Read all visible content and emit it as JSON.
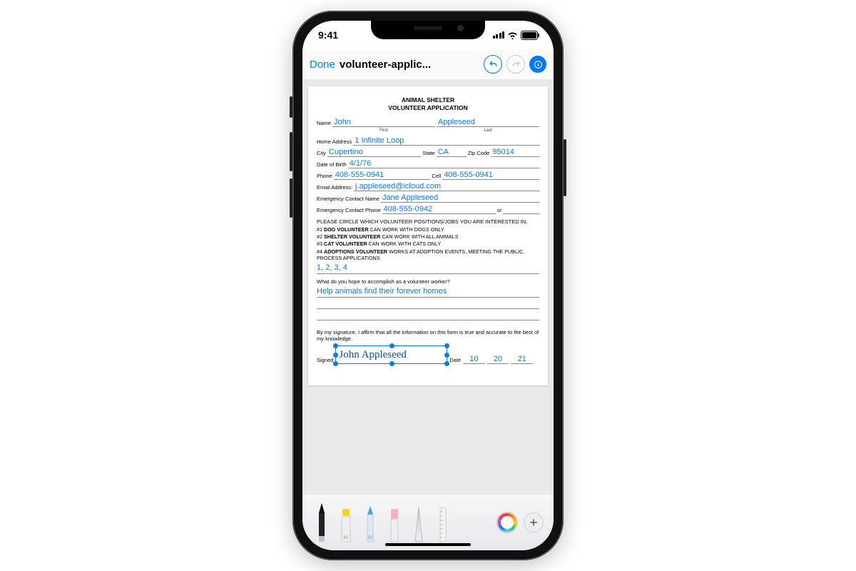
{
  "status": {
    "time": "9:41"
  },
  "nav": {
    "done": "Done",
    "title": "volunteer-applic..."
  },
  "form": {
    "header1": "ANIMAL SHELTER",
    "header2": "VOLUNTEER APPLICATION",
    "labels": {
      "name": "Name",
      "first": "First",
      "last": "Last",
      "addr": "Home Address",
      "city": "City",
      "state": "State",
      "zip": "Zip Code",
      "dob": "Date of Birth",
      "phone": "Phone",
      "cell": "Cell",
      "email": "Email Address:",
      "ec_name": "Emergency Contact Name",
      "ec_phone": "Emergency Contact Phone",
      "or": "or",
      "signed": "Signed",
      "date": "Date"
    },
    "values": {
      "first": "John",
      "last": "Appleseed",
      "addr": "1 Infinite Loop",
      "city": "Cupertino",
      "state": "CA",
      "zip": "95014",
      "dob": "4/1/76",
      "phone": "408-555-0941",
      "cell": "408-555-0941",
      "email": "j.appleseed@icloud.com",
      "ec_name": "Jane Appleseed",
      "ec_phone": "408-555-0942",
      "positions_answer": "1, 2, 3, 4",
      "accomplish_answer": "Help animals find their forever homes",
      "signature": "John Appleseed",
      "date_m": "10",
      "date_d": "20",
      "date_y": "21"
    },
    "text": {
      "positions_prompt": "PLEASE CIRCLE WHICH VOLUNTEER POSITIONS/JOBS YOU ARE INTERESTED IN.",
      "p1": "#1 DOG VOLUNTEER CAN WORK WITH DOGS ONLY",
      "p1b": "DOG VOLUNTEER",
      "p1r": " CAN WORK WITH DOGS ONLY",
      "p2b": "SHELTER VOLUNTEER",
      "p2r": " CAN WORK WITH ALL ANIMALS",
      "p3b": "CAT VOLUNTEER",
      "p3r": " CAN WORK WITH CATS ONLY",
      "p4b": "ADOPTIONS VOLUNTEER",
      "p4r": " WORKS AT ADOPTION EVENTS, MEETING THE PUBLIC, PROCESS APPLICATIONS",
      "accomplish_q": "What do you hope to accomplish as a volunteer worker?",
      "affirm": "By my signature, I affirm that all the information on this form is true and accurate to the best of my knowledge."
    }
  },
  "tools": {
    "pen_cap": "",
    "hl_cap": "80",
    "pencil_cap": "50"
  }
}
